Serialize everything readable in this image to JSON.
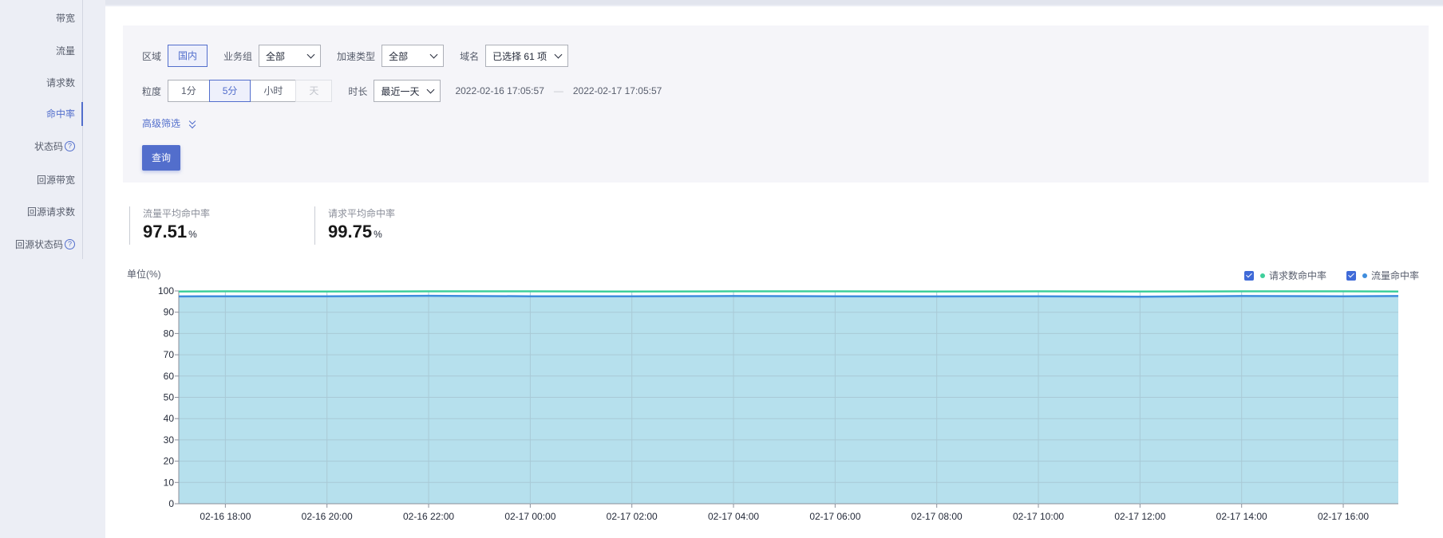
{
  "sidebar": {
    "items": [
      {
        "label": "带宽",
        "active": false,
        "help": false
      },
      {
        "label": "流量",
        "active": false,
        "help": false
      },
      {
        "label": "请求数",
        "active": false,
        "help": false
      },
      {
        "label": "命中率",
        "active": true,
        "help": false
      },
      {
        "label": "状态码",
        "active": false,
        "help": true
      },
      {
        "label": "回源带宽",
        "active": false,
        "help": false
      },
      {
        "label": "回源请求数",
        "active": false,
        "help": false
      },
      {
        "label": "回源状态码",
        "active": false,
        "help": true
      }
    ],
    "help_glyph": "?"
  },
  "filters": {
    "region_label": "区域",
    "region_options": [
      "国内"
    ],
    "business_group_label": "业务组",
    "business_group_value": "全部",
    "accel_type_label": "加速类型",
    "accel_type_value": "全部",
    "domain_label": "域名",
    "domain_value": "已选择 61 项",
    "granularity_label": "粒度",
    "granularity_options": [
      {
        "label": "1分",
        "state": "normal"
      },
      {
        "label": "5分",
        "state": "selected"
      },
      {
        "label": "小时",
        "state": "normal"
      },
      {
        "label": "天",
        "state": "disabled"
      }
    ],
    "duration_label": "时长",
    "duration_value": "最近一天",
    "start_time": "2022-02-16 17:05:57",
    "range_sep": "—",
    "end_time": "2022-02-17 17:05:57",
    "advanced_filter": "高级筛选",
    "query_button": "查询"
  },
  "stats": [
    {
      "label": "流量平均命中率",
      "value": "97.51",
      "unit": "%"
    },
    {
      "label": "请求平均命中率",
      "value": "99.75",
      "unit": "%"
    }
  ],
  "colors": {
    "accent": "#526ecc",
    "request_series": "#3ecf9b",
    "traffic_series": "#3f8ddd",
    "area_fill": "#b6e0ed",
    "checkbox": "#3f6ad8"
  },
  "chart_data": {
    "type": "area",
    "unit_label": "单位(%)",
    "ylim": [
      0,
      100
    ],
    "yticks": [
      0,
      10,
      20,
      30,
      40,
      50,
      60,
      70,
      80,
      90,
      100
    ],
    "x_tick_labels": [
      "02-16 18:00",
      "02-16 20:00",
      "02-16 22:00",
      "02-17 00:00",
      "02-17 02:00",
      "02-17 04:00",
      "02-17 06:00",
      "02-17 08:00",
      "02-17 10:00",
      "02-17 12:00",
      "02-17 14:00",
      "02-17 16:00"
    ],
    "legend": [
      {
        "name": "请求数命中率",
        "checked": true
      },
      {
        "name": "流量命中率",
        "checked": true
      }
    ],
    "series": [
      {
        "name": "请求数命中率",
        "x": [
          "02-16 17:05",
          "02-16 18:00",
          "02-16 20:00",
          "02-16 22:00",
          "02-17 00:00",
          "02-17 02:00",
          "02-17 04:00",
          "02-17 06:00",
          "02-17 08:00",
          "02-17 10:00",
          "02-17 12:00",
          "02-17 14:00",
          "02-17 16:00",
          "02-17 17:05"
        ],
        "values": [
          99.7,
          99.8,
          99.7,
          99.8,
          99.8,
          99.7,
          99.8,
          99.8,
          99.7,
          99.8,
          99.7,
          99.8,
          99.8,
          99.7
        ]
      },
      {
        "name": "流量命中率",
        "x": [
          "02-16 17:05",
          "02-16 18:00",
          "02-16 20:00",
          "02-16 22:00",
          "02-17 00:00",
          "02-17 02:00",
          "02-17 04:00",
          "02-17 06:00",
          "02-17 08:00",
          "02-17 10:00",
          "02-17 12:00",
          "02-17 14:00",
          "02-17 16:00",
          "02-17 17:05"
        ],
        "values": [
          97.4,
          97.5,
          97.5,
          97.7,
          97.5,
          97.5,
          97.6,
          97.5,
          97.4,
          97.5,
          97.3,
          97.6,
          97.5,
          97.6
        ]
      }
    ],
    "grid": true
  }
}
